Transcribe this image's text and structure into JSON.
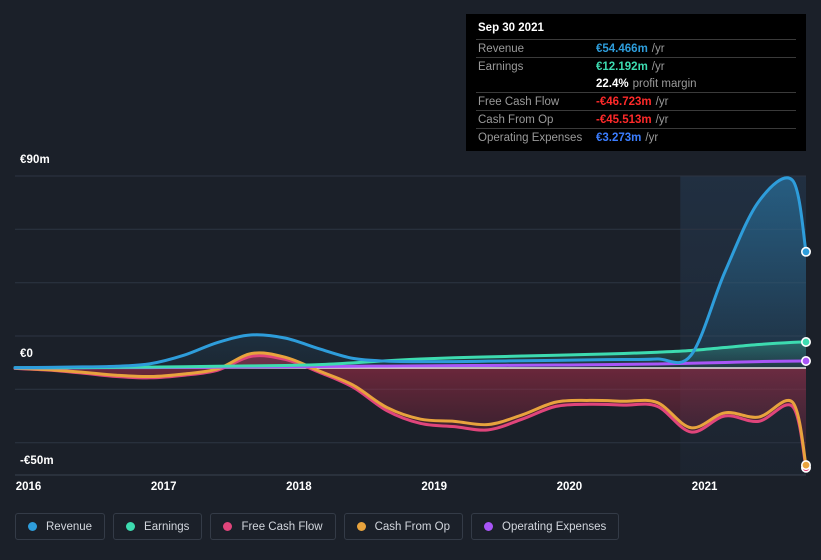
{
  "chart_data": {
    "type": "area",
    "title": "",
    "xlabel": "",
    "ylabel": "",
    "currency": "EUR",
    "units": "millions",
    "grid": true,
    "legend_position": "bottom",
    "ylim": [
      -50,
      90
    ],
    "y_ticks": [
      {
        "value": 90,
        "label": "€90m"
      },
      {
        "value": 0,
        "label": "€0"
      },
      {
        "value": -50,
        "label": "-€50m"
      }
    ],
    "x_ticks": [
      "2016",
      "2017",
      "2018",
      "2019",
      "2020",
      "2021"
    ],
    "x": [
      2015.9,
      2016.15,
      2016.4,
      2016.65,
      2016.9,
      2017.15,
      2017.4,
      2017.65,
      2017.9,
      2018.15,
      2018.4,
      2018.65,
      2018.9,
      2019.15,
      2019.4,
      2019.65,
      2019.9,
      2020.15,
      2020.4,
      2020.65,
      2020.9,
      2021.15,
      2021.4,
      2021.65,
      2021.75
    ],
    "series": [
      {
        "name": "Revenue",
        "color": "#2e9ddb",
        "values": [
          0.2,
          0.3,
          0.5,
          0.8,
          2.0,
          6.0,
          12.0,
          15.5,
          14.0,
          9.0,
          4.5,
          3.2,
          3.0,
          3.0,
          3.2,
          3.4,
          3.6,
          3.8,
          4.0,
          4.2,
          6.0,
          45.0,
          78.0,
          88.0,
          54.466
        ]
      },
      {
        "name": "Earnings",
        "color": "#3ddbb0",
        "values": [
          0.1,
          0.1,
          0.2,
          0.3,
          0.4,
          0.6,
          0.8,
          1.0,
          1.2,
          1.6,
          2.4,
          3.4,
          4.2,
          4.8,
          5.2,
          5.6,
          6.0,
          6.4,
          6.8,
          7.4,
          8.2,
          9.6,
          11.0,
          12.0,
          12.192
        ]
      },
      {
        "name": "Free Cash Flow",
        "color": "#e0457b",
        "values": [
          -0.2,
          -1.0,
          -2.4,
          -4.0,
          -4.6,
          -3.4,
          -1.0,
          5.5,
          4.0,
          -2.0,
          -9.0,
          -20.0,
          -26.0,
          -27.5,
          -29.0,
          -24.0,
          -18.0,
          -17.0,
          -17.4,
          -18.0,
          -30.0,
          -22.5,
          -25.0,
          -18.0,
          -46.723
        ]
      },
      {
        "name": "Cash From Op",
        "color": "#e8a33d",
        "values": [
          -0.1,
          -0.8,
          -2.0,
          -3.4,
          -4.0,
          -2.8,
          -0.4,
          6.8,
          5.0,
          -1.4,
          -8.0,
          -18.5,
          -24.0,
          -25.0,
          -26.5,
          -22.0,
          -16.0,
          -15.2,
          -15.6,
          -16.2,
          -28.0,
          -21.0,
          -23.0,
          -16.0,
          -45.513
        ]
      },
      {
        "name": "Operating Expenses",
        "color": "#a855f7",
        "values": [
          0.0,
          0.05,
          0.1,
          0.15,
          0.2,
          0.3,
          0.4,
          0.5,
          0.6,
          0.7,
          0.8,
          0.9,
          1.0,
          1.1,
          1.2,
          1.3,
          1.4,
          1.5,
          1.7,
          1.9,
          2.2,
          2.6,
          3.0,
          3.2,
          3.273
        ]
      }
    ],
    "forecast_boundary_year": 2020.82
  },
  "tooltip": {
    "title": "Sep 30 2021",
    "rows": [
      {
        "name": "Revenue",
        "value": "€54.466m",
        "unit": "/yr",
        "color_class": "c-revenue"
      },
      {
        "name": "Earnings",
        "value": "€12.192m",
        "unit": "/yr",
        "color_class": "c-earnings"
      },
      {
        "name": "",
        "value": "22.4%",
        "unit": "profit margin",
        "color_class": "c-white"
      },
      {
        "name": "Free Cash Flow",
        "value": "-€46.723m",
        "unit": "/yr",
        "color_class": "c-fcf"
      },
      {
        "name": "Cash From Op",
        "value": "-€45.513m",
        "unit": "/yr",
        "color_class": "c-cfo"
      },
      {
        "name": "Operating Expenses",
        "value": "€3.273m",
        "unit": "/yr",
        "color_class": "c-opex"
      }
    ]
  },
  "legend": {
    "items": [
      {
        "label": "Revenue",
        "color": "#2e9ddb"
      },
      {
        "label": "Earnings",
        "color": "#3ddbb0"
      },
      {
        "label": "Free Cash Flow",
        "color": "#e0457b"
      },
      {
        "label": "Cash From Op",
        "color": "#e8a33d"
      },
      {
        "label": "Operating Expenses",
        "color": "#a855f7"
      }
    ]
  },
  "theme": {
    "background": "#1b2029",
    "gridline": "#2d3542",
    "zero_line": "#e8e8e8",
    "tooltip_background": "#000000",
    "tooltip_rule": "#3a3a3a",
    "tooltip_label": "#9a9a9a",
    "axis_text": "#ffffff"
  }
}
